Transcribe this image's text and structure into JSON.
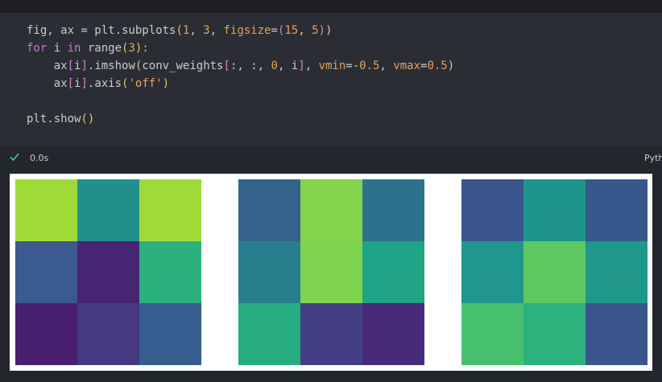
{
  "code_cell": {
    "lines": [
      [
        {
          "t": "fig, ax = plt.subplots",
          "c": "tok-fn"
        },
        {
          "t": "(",
          "c": "tok-paren"
        },
        {
          "t": "1",
          "c": "tok-num"
        },
        {
          "t": ", ",
          "c": "tok-op"
        },
        {
          "t": "3",
          "c": "tok-num"
        },
        {
          "t": ", ",
          "c": "tok-op"
        },
        {
          "t": "figsize",
          "c": "tok-param"
        },
        {
          "t": "=",
          "c": "tok-op"
        },
        {
          "t": "(",
          "c": "tok-sq"
        },
        {
          "t": "15",
          "c": "tok-num"
        },
        {
          "t": ", ",
          "c": "tok-op"
        },
        {
          "t": "5",
          "c": "tok-num"
        },
        {
          "t": ")",
          "c": "tok-sq"
        },
        {
          "t": ")",
          "c": "tok-paren"
        }
      ],
      [
        {
          "t": "for",
          "c": "tok-kw"
        },
        {
          "t": " i ",
          "c": "tok-op"
        },
        {
          "t": "in",
          "c": "tok-kw"
        },
        {
          "t": " range",
          "c": "tok-fn"
        },
        {
          "t": "(",
          "c": "tok-paren"
        },
        {
          "t": "3",
          "c": "tok-num"
        },
        {
          "t": "):",
          "c": "tok-paren"
        }
      ],
      [
        {
          "t": "    ax",
          "c": "tok-op"
        },
        {
          "t": "[",
          "c": "tok-sq"
        },
        {
          "t": "i",
          "c": "tok-op"
        },
        {
          "t": "]",
          "c": "tok-sq"
        },
        {
          "t": ".imshow",
          "c": "tok-fn"
        },
        {
          "t": "(",
          "c": "tok-paren"
        },
        {
          "t": "conv_weights",
          "c": "tok-op"
        },
        {
          "t": "[",
          "c": "tok-sq"
        },
        {
          "t": ":, :, ",
          "c": "tok-op"
        },
        {
          "t": "0",
          "c": "tok-num"
        },
        {
          "t": ", i",
          "c": "tok-op"
        },
        {
          "t": "]",
          "c": "tok-sq"
        },
        {
          "t": ", ",
          "c": "tok-op"
        },
        {
          "t": "vmin",
          "c": "tok-param"
        },
        {
          "t": "=-",
          "c": "tok-op"
        },
        {
          "t": "0.5",
          "c": "tok-num"
        },
        {
          "t": ", ",
          "c": "tok-op"
        },
        {
          "t": "vmax",
          "c": "tok-param"
        },
        {
          "t": "=",
          "c": "tok-op"
        },
        {
          "t": "0.5",
          "c": "tok-num"
        },
        {
          "t": ")",
          "c": "tok-paren"
        }
      ],
      [
        {
          "t": "    ax",
          "c": "tok-op"
        },
        {
          "t": "[",
          "c": "tok-sq"
        },
        {
          "t": "i",
          "c": "tok-op"
        },
        {
          "t": "]",
          "c": "tok-sq"
        },
        {
          "t": ".axis",
          "c": "tok-fn"
        },
        {
          "t": "(",
          "c": "tok-paren"
        },
        {
          "t": "'off'",
          "c": "tok-str"
        },
        {
          "t": ")",
          "c": "tok-paren"
        }
      ],
      [],
      [
        {
          "t": "plt.show",
          "c": "tok-fn"
        },
        {
          "t": "()",
          "c": "tok-paren"
        }
      ]
    ]
  },
  "status": {
    "check_icon": "check-icon",
    "exec_time": "0.0s",
    "language": "Pyth",
    "check_color": "#4ec985"
  },
  "output": {
    "panels": [
      {
        "colors": [
          [
            "#a0da39",
            "#21908d",
            "#a0da39"
          ],
          [
            "#3b5a8f",
            "#482475",
            "#2cb17e"
          ],
          [
            "#481f70",
            "#453781",
            "#365d8d"
          ]
        ]
      },
      {
        "colors": [
          [
            "#33638d",
            "#84d44b",
            "#2c728e"
          ],
          [
            "#277f8e",
            "#7ed34f",
            "#20a486"
          ],
          [
            "#26ad81",
            "#433e85",
            "#472a7a"
          ]
        ]
      },
      {
        "colors": [
          [
            "#3a548c",
            "#1f948c",
            "#38588c"
          ],
          [
            "#1f968b",
            "#5ec962",
            "#1f988b"
          ],
          [
            "#48c16e",
            "#2db27d",
            "#39568c"
          ]
        ]
      }
    ]
  }
}
